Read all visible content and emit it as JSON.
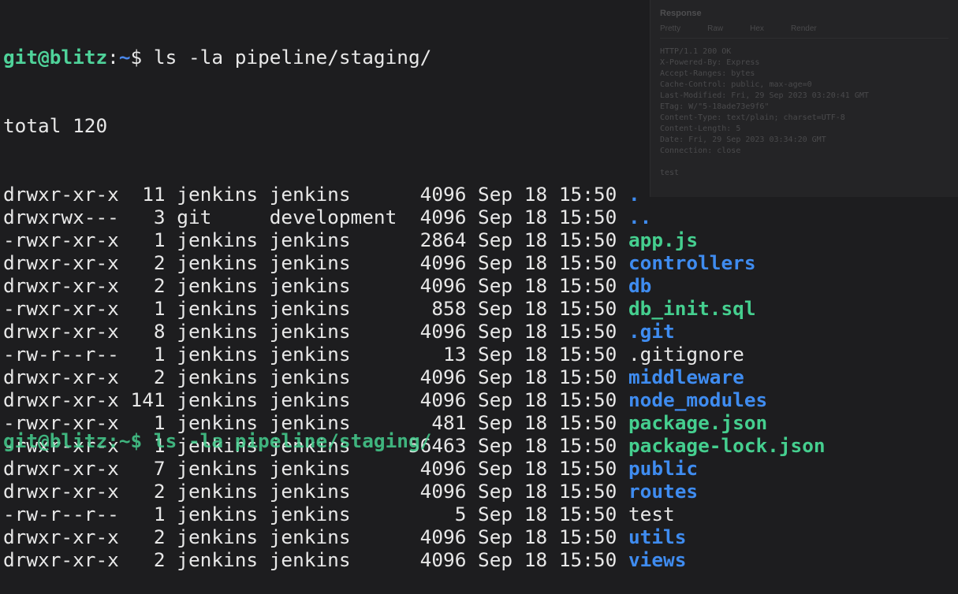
{
  "background_window": {
    "title": "Response",
    "tabs": [
      "Pretty",
      "Raw",
      "Hex",
      "Render"
    ],
    "lines": [
      "HTTP/1.1 200 OK",
      "X-Powered-By: Express",
      "Accept-Ranges: bytes",
      "Cache-Control: public, max-age=0",
      "Last-Modified: Fri, 29 Sep 2023 03:20:41 GMT",
      "ETag: W/\"5-18ade73e9f6\"",
      "Content-Type: text/plain; charset=UTF-8",
      "Content-Length: 5",
      "Date: Fri, 29 Sep 2023 03:34:20 GMT",
      "Connection: close",
      "",
      "test"
    ]
  },
  "terminal": {
    "prompt": {
      "user_host": "git@blitz",
      "separator": ":",
      "path": "~",
      "symbol": "$ ",
      "command": "ls -la pipeline/staging/"
    },
    "total_line": "total 120",
    "entries": [
      {
        "perms": "drwxr-xr-x",
        "links": "11",
        "owner": "jenkins",
        "group": "jenkins",
        "size": "4096",
        "month": "Sep",
        "day": "18",
        "time": "15:50",
        "name": ".",
        "type": "dir"
      },
      {
        "perms": "drwxrwx---",
        "links": "3",
        "owner": "git",
        "group": "development",
        "size": "4096",
        "month": "Sep",
        "day": "18",
        "time": "15:50",
        "name": "..",
        "type": "dir"
      },
      {
        "perms": "-rwxr-xr-x",
        "links": "1",
        "owner": "jenkins",
        "group": "jenkins",
        "size": "2864",
        "month": "Sep",
        "day": "18",
        "time": "15:50",
        "name": "app.js",
        "type": "exec"
      },
      {
        "perms": "drwxr-xr-x",
        "links": "2",
        "owner": "jenkins",
        "group": "jenkins",
        "size": "4096",
        "month": "Sep",
        "day": "18",
        "time": "15:50",
        "name": "controllers",
        "type": "dir"
      },
      {
        "perms": "drwxr-xr-x",
        "links": "2",
        "owner": "jenkins",
        "group": "jenkins",
        "size": "4096",
        "month": "Sep",
        "day": "18",
        "time": "15:50",
        "name": "db",
        "type": "dir"
      },
      {
        "perms": "-rwxr-xr-x",
        "links": "1",
        "owner": "jenkins",
        "group": "jenkins",
        "size": "858",
        "month": "Sep",
        "day": "18",
        "time": "15:50",
        "name": "db_init.sql",
        "type": "exec"
      },
      {
        "perms": "drwxr-xr-x",
        "links": "8",
        "owner": "jenkins",
        "group": "jenkins",
        "size": "4096",
        "month": "Sep",
        "day": "18",
        "time": "15:50",
        "name": ".git",
        "type": "dir"
      },
      {
        "perms": "-rw-r--r--",
        "links": "1",
        "owner": "jenkins",
        "group": "jenkins",
        "size": "13",
        "month": "Sep",
        "day": "18",
        "time": "15:50",
        "name": ".gitignore",
        "type": "file"
      },
      {
        "perms": "drwxr-xr-x",
        "links": "2",
        "owner": "jenkins",
        "group": "jenkins",
        "size": "4096",
        "month": "Sep",
        "day": "18",
        "time": "15:50",
        "name": "middleware",
        "type": "dir"
      },
      {
        "perms": "drwxr-xr-x",
        "links": "141",
        "owner": "jenkins",
        "group": "jenkins",
        "size": "4096",
        "month": "Sep",
        "day": "18",
        "time": "15:50",
        "name": "node_modules",
        "type": "dir"
      },
      {
        "perms": "-rwxr-xr-x",
        "links": "1",
        "owner": "jenkins",
        "group": "jenkins",
        "size": "481",
        "month": "Sep",
        "day": "18",
        "time": "15:50",
        "name": "package.json",
        "type": "exec"
      },
      {
        "perms": "-rwxr-xr-x",
        "links": "1",
        "owner": "jenkins",
        "group": "jenkins",
        "size": "56463",
        "month": "Sep",
        "day": "18",
        "time": "15:50",
        "name": "package-lock.json",
        "type": "exec"
      },
      {
        "perms": "drwxr-xr-x",
        "links": "7",
        "owner": "jenkins",
        "group": "jenkins",
        "size": "4096",
        "month": "Sep",
        "day": "18",
        "time": "15:50",
        "name": "public",
        "type": "dir"
      },
      {
        "perms": "drwxr-xr-x",
        "links": "2",
        "owner": "jenkins",
        "group": "jenkins",
        "size": "4096",
        "month": "Sep",
        "day": "18",
        "time": "15:50",
        "name": "routes",
        "type": "dir"
      },
      {
        "perms": "-rw-r--r--",
        "links": "1",
        "owner": "jenkins",
        "group": "jenkins",
        "size": "5",
        "month": "Sep",
        "day": "18",
        "time": "15:50",
        "name": "test",
        "type": "file"
      },
      {
        "perms": "drwxr-xr-x",
        "links": "2",
        "owner": "jenkins",
        "group": "jenkins",
        "size": "4096",
        "month": "Sep",
        "day": "18",
        "time": "15:50",
        "name": "utils",
        "type": "dir"
      },
      {
        "perms": "drwxr-xr-x",
        "links": "2",
        "owner": "jenkins",
        "group": "jenkins",
        "size": "4096",
        "month": "Sep",
        "day": "18",
        "time": "15:50",
        "name": "views",
        "type": "dir"
      }
    ],
    "cut_off_prompt": "git@blitz:~$ ls -la pipeline/staging/"
  }
}
